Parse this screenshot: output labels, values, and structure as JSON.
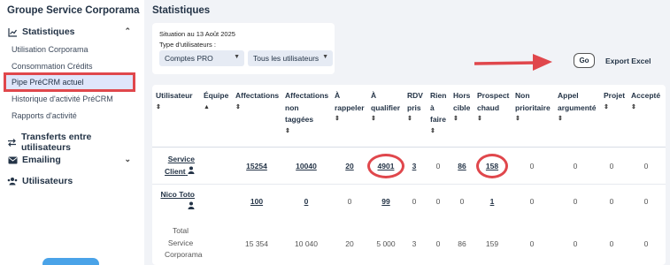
{
  "sidebar": {
    "brand": "Groupe Service Corporama",
    "sections": [
      {
        "label": "Statistiques",
        "expanded": true
      },
      {
        "label": "Transferts entre utilisateurs"
      },
      {
        "label": "Emailing",
        "expanded": false
      },
      {
        "label": "Utilisateurs"
      }
    ],
    "stats_items": [
      {
        "label": "Utilisation Corporama"
      },
      {
        "label": "Consommation Crédits"
      },
      {
        "label": "Pipe PréCRM actuel",
        "active": true
      },
      {
        "label": "Historique d'activité PréCRM"
      },
      {
        "label": "Rapports d'activité"
      }
    ]
  },
  "page": {
    "title": "Statistiques"
  },
  "filters": {
    "date_text": "Situation au 13 Août 2025",
    "type_label": "Type d'utilisateurs :",
    "account_select": "Comptes PRO",
    "users_select": "Tous les utilisateurs",
    "go_label": "Go",
    "export_label": "Export Excel"
  },
  "table": {
    "headers": [
      {
        "l1": "Utilisateur",
        "l2": "",
        "l3": "",
        "sort": "⇕"
      },
      {
        "l1": "Équipe",
        "l2": "",
        "l3": "",
        "sort": "▲"
      },
      {
        "l1": "Affectations",
        "l2": "",
        "l3": "",
        "sort": "⇕"
      },
      {
        "l1": "Affectations",
        "l2": "non",
        "l3": "taggées",
        "sort": "⇕"
      },
      {
        "l1": "À",
        "l2": "rappeler",
        "l3": "",
        "sort": "⇕"
      },
      {
        "l1": "À",
        "l2": "qualifier",
        "l3": "",
        "sort": "⇕"
      },
      {
        "l1": "RDV",
        "l2": "pris",
        "l3": "",
        "sort": "⇕"
      },
      {
        "l1": "Rien",
        "l2": "à",
        "l3": "faire",
        "sort": "⇕"
      },
      {
        "l1": "Hors",
        "l2": "cible",
        "l3": "",
        "sort": "⇕"
      },
      {
        "l1": "Prospect",
        "l2": "chaud",
        "l3": "",
        "sort": "⇕"
      },
      {
        "l1": "Non",
        "l2": "prioritaire",
        "l3": "",
        "sort": "⇕"
      },
      {
        "l1": "Appel",
        "l2": "argumenté",
        "l3": "",
        "sort": "⇕"
      },
      {
        "l1": "Projet",
        "l2": "",
        "l3": "",
        "sort": "⇕"
      },
      {
        "l1": "Accepté",
        "l2": "",
        "l3": "",
        "sort": "⇕"
      }
    ],
    "rows": [
      {
        "user_l1": "Service",
        "user_l2": "Client",
        "values": [
          "15254",
          "10040",
          "20",
          "4901",
          "3",
          "0",
          "86",
          "158",
          "0",
          "0",
          "0",
          "0"
        ]
      },
      {
        "user_l1": "Nico Toto",
        "user_l2": "",
        "values": [
          "100",
          "0",
          "0",
          "99",
          "0",
          "0",
          "0",
          "1",
          "0",
          "0",
          "0",
          "0"
        ]
      }
    ],
    "total": {
      "label_l1": "Total",
      "label_l2": "Service",
      "label_l3": "Corporama",
      "values": [
        "15 354",
        "10 040",
        "20",
        "5 000",
        "3",
        "0",
        "86",
        "159",
        "0",
        "0",
        "0",
        "0"
      ]
    }
  },
  "colors": {
    "highlight": "#e0474c",
    "active_bg": "#dfe6fb"
  }
}
